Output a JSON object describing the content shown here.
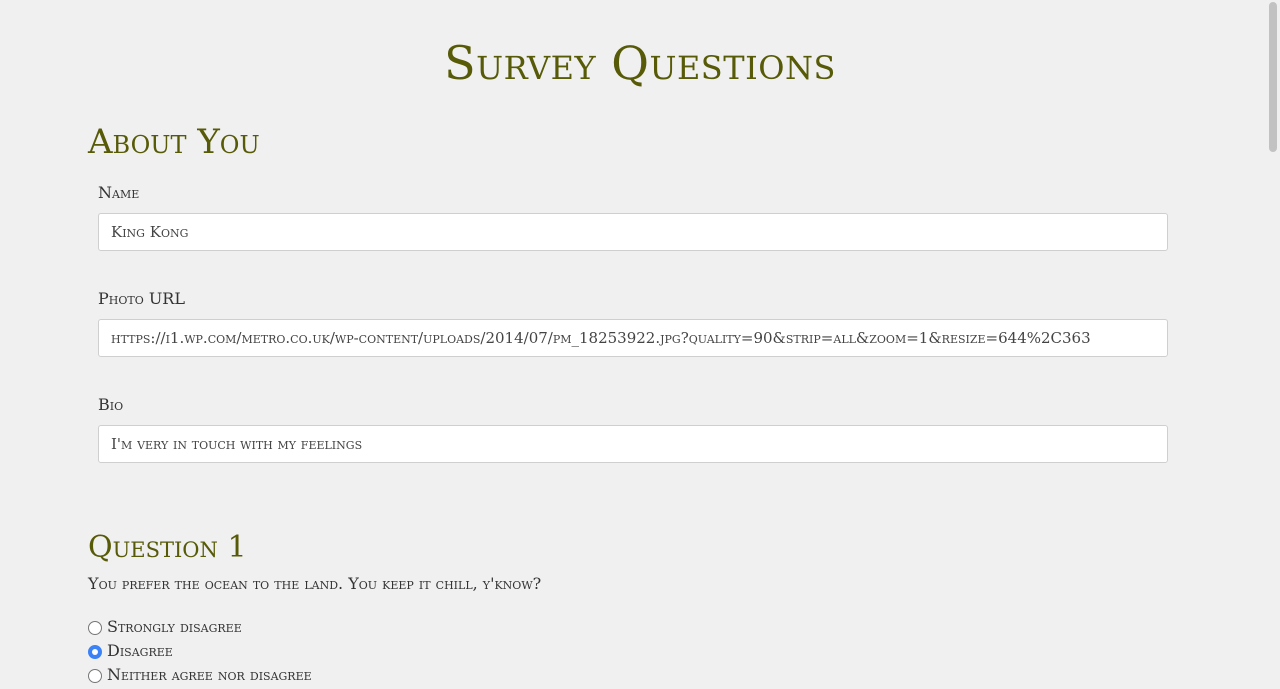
{
  "page_title": "Survey Questions",
  "about": {
    "heading": "About You",
    "name": {
      "label": "Name",
      "value": "King Kong"
    },
    "photo": {
      "label": "Photo URL",
      "value": "https://i1.wp.com/metro.co.uk/wp-content/uploads/2014/07/pm_18253922.jpg?quality=90&strip=all&zoom=1&resize=644%2C363"
    },
    "bio": {
      "label": "Bio",
      "value": "I'm very in touch with my feelings"
    }
  },
  "question1": {
    "heading": "Question 1",
    "text": "You prefer the ocean to the land. You keep it chill, y'know?",
    "options": [
      {
        "label": "Strongly disagree",
        "checked": false
      },
      {
        "label": "Disagree",
        "checked": true
      },
      {
        "label": "Neither agree nor disagree",
        "checked": false
      }
    ]
  },
  "colors": {
    "heading": "#575a07",
    "radio_checked": "#3b82f6",
    "background": "#f0f0f0"
  }
}
